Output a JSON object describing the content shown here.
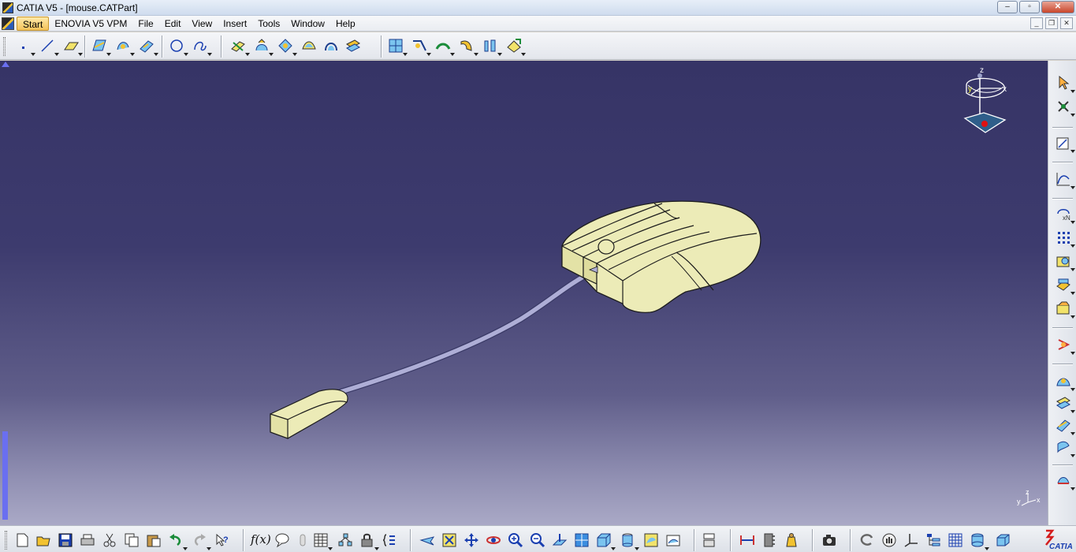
{
  "window": {
    "title": "CATIA V5 - [mouse.CATPart]",
    "minimize_label": "‒",
    "maximize_label": "▫",
    "close_label": "✕"
  },
  "menu": {
    "items": [
      "Start",
      "ENOVIA V5 VPM",
      "File",
      "Edit",
      "View",
      "Insert",
      "Tools",
      "Window",
      "Help"
    ]
  },
  "document_controls": {
    "minimize_label": "_",
    "restore_label": "❐",
    "close_label": "✕"
  },
  "compass": {
    "axis_x": "x",
    "axis_y": "y",
    "axis_z": "z"
  },
  "axis_triad": {
    "x": "x",
    "y": "y",
    "z": "z"
  },
  "formula_label": "f(x)",
  "brand_logo_text": "CATIA",
  "colors": {
    "viewport_top": "#363466",
    "viewport_bottom": "#aaa9c6",
    "part_fill": "#ecebb7",
    "cable": "#aeaed6"
  },
  "icons": {
    "top": [
      "point-icon",
      "line-icon",
      "plane-icon",
      "extrude-surface-icon",
      "revolve-surface-icon",
      "sweep-surface-icon",
      "circle-icon",
      "spline-icon",
      "split-icon",
      "trim-icon",
      "join-icon",
      "healing-icon",
      "blend-icon",
      "fill-icon",
      "boolean-icon",
      "fillet-icon",
      "shell-icon",
      "draft-icon",
      "thickness-icon",
      "transform-icon"
    ],
    "right": [
      "select-arrow-icon",
      "snap-icon",
      "sketcher-icon",
      "curve-icon",
      "offset-icon",
      "pattern-icon",
      "measure-icon",
      "analysis-icon",
      "material-icon",
      "tree-icon",
      "render-icon",
      "surface-icon",
      "wireframe-icon",
      "swept-icon",
      "settings-icon"
    ],
    "bottom": [
      "new-icon",
      "open-icon",
      "save-icon",
      "print-icon",
      "cut-icon",
      "copy-icon",
      "paste-icon",
      "undo-icon",
      "redo-icon",
      "whats-this-icon",
      "formula-icon",
      "annotation-icon",
      "parameter-icon",
      "table-icon",
      "catalog-icon",
      "lock-icon",
      "knowledge-icon",
      "fly-mode-icon",
      "fit-all-icon",
      "pan-icon",
      "rotate-icon",
      "zoom-in-icon",
      "zoom-out-icon",
      "normal-view-icon",
      "iso-view-icon",
      "front-view-icon",
      "cylinder-view-icon",
      "shading-icon",
      "edges-icon",
      "multiview-icon",
      "measure-between-icon",
      "measure-item-icon",
      "inertia-icon",
      "capture-icon",
      "update-icon",
      "grab-icon",
      "axis-icon",
      "spec-tree-icon",
      "grid-icon",
      "cylinder-icon",
      "box-icon"
    ]
  }
}
